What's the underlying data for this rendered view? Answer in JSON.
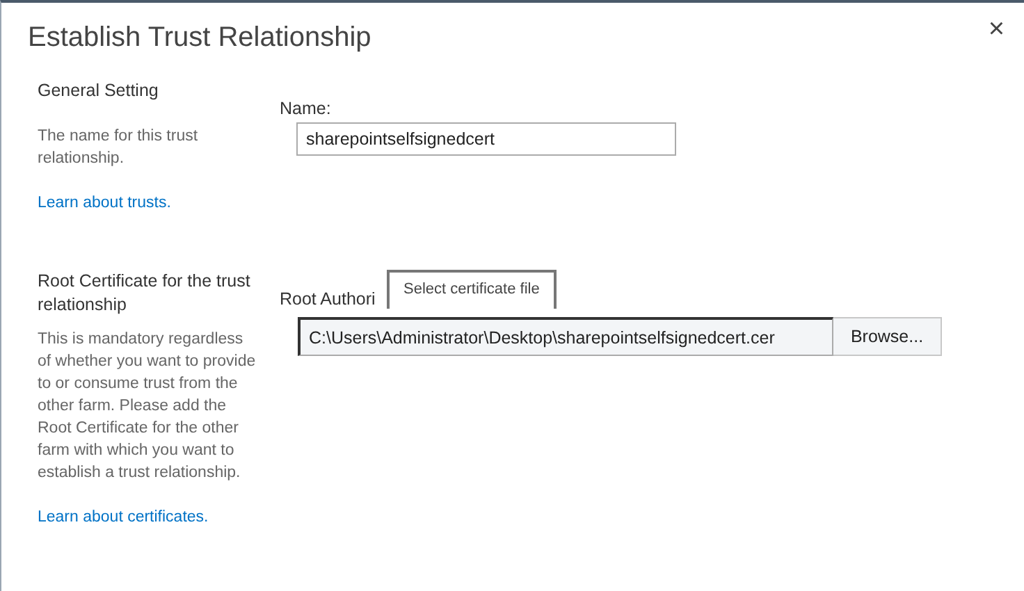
{
  "dialog": {
    "title": "Establish Trust Relationship",
    "close": "×"
  },
  "sections": [
    {
      "heading": "General Setting",
      "description": "The name for this trust relationship.",
      "link": "Learn about trusts.",
      "field": {
        "kind": "text",
        "label": "Name:",
        "value": "sharepointselfsignedcert"
      }
    },
    {
      "heading": "Root Certificate for the trust relationship",
      "description": "This is mandatory regardless of whether you want to provide to or consume trust from the other farm. Please add the Root Certificate for the other farm with which you want to establish a trust relationship.",
      "link": "Learn about certificates.",
      "field": {
        "kind": "file",
        "label": "Root Authori",
        "value": "C:\\Users\\Administrator\\Desktop\\sharepointselfsignedcert.cer",
        "button": "Browse...",
        "tooltip": "Select certificate file"
      }
    }
  ]
}
